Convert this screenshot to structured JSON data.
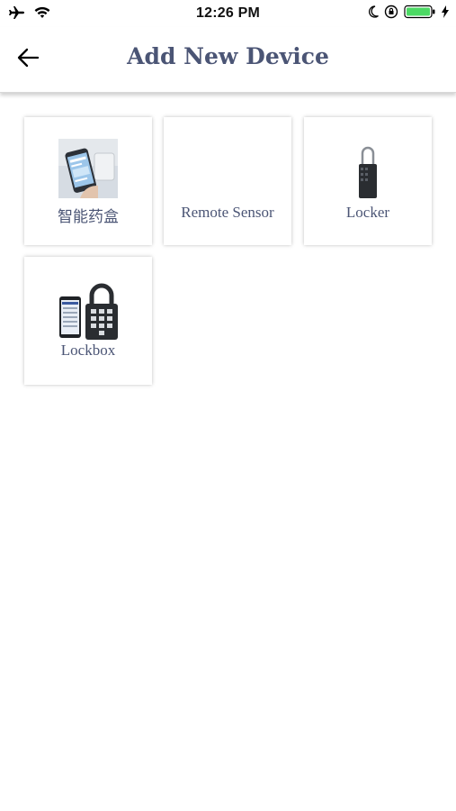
{
  "status_bar": {
    "time": "12:26 PM"
  },
  "header": {
    "title": "Add New Device"
  },
  "devices": [
    {
      "label": "智能药盒",
      "icon": "phone-app-image"
    },
    {
      "label": "Remote Sensor",
      "icon": ""
    },
    {
      "label": "Locker",
      "icon": "key-lock-image"
    },
    {
      "label": "Lockbox",
      "icon": "lockbox-image"
    }
  ],
  "colors": {
    "title": "#4b5575",
    "label": "#4b5575",
    "battery": "#4cd964"
  }
}
